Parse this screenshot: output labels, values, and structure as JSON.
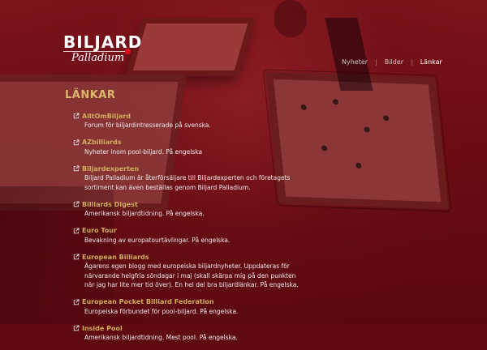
{
  "logo": {
    "main": "BILJARD",
    "sub": "Palladium"
  },
  "nav": {
    "items": [
      "Nyheter",
      "Bilder",
      "Länkar"
    ]
  },
  "page": {
    "title": "LÄNKAR"
  },
  "links": [
    {
      "title": "AlltOmBiljard",
      "desc": "Forum för biljardintresserade på svenska."
    },
    {
      "title": "AZbilliards",
      "desc": "Nyheter inom pool-biljard. På engelska"
    },
    {
      "title": "Biljardexperten",
      "desc": "Biljard Palladium är återförsäljare till Biljardexperten och företagets sortiment kan även beställas genom Biljard Palladium."
    },
    {
      "title": "Billiards Digest",
      "desc": "Amerikansk biljardtidning. På engelska."
    },
    {
      "title": "Euro Tour",
      "desc": "Bevakning av europatourtävlingar. På engelska."
    },
    {
      "title": "European Billiards",
      "desc": "Ägarens egen blogg med europeiska biljardnyheter. Uppdateras för närvarande helgfria söndagar i maj (skall skärpa mig på den punkten när jag har lite mer tid över). En hel del bra biljardlänkar. På engelska."
    },
    {
      "title": "European Pocket Billiard Federation",
      "desc": "Europeiska förbundet för pool-biljard. På engelska."
    },
    {
      "title": "Inside Pool",
      "desc": "Amerikansk biljardtidning. Mest pool. På engelska."
    }
  ],
  "colors": {
    "title": "#d9b76b",
    "link": "#d0ad5a",
    "text": "#eeeaea",
    "logo_dot": "#e10d1b"
  },
  "icons": {
    "external_link": "external-link-icon"
  }
}
